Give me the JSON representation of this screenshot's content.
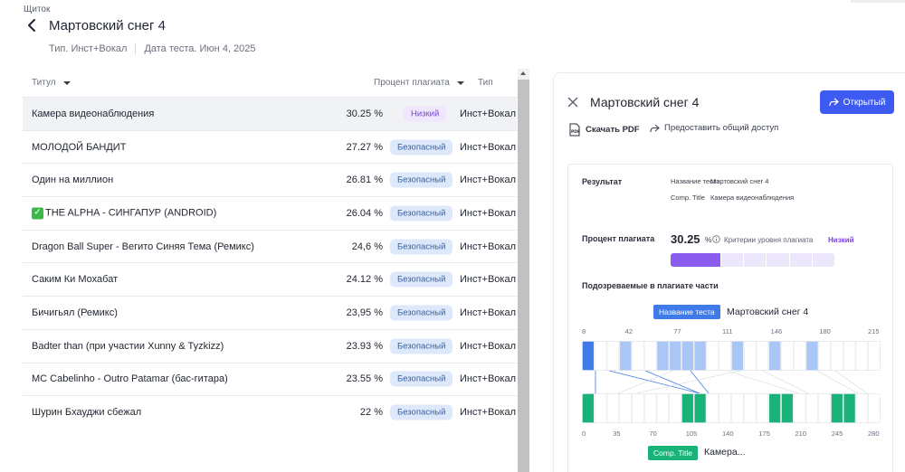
{
  "breadcrumb": "Щиток",
  "page_title": "Мартовский снег 4",
  "meta": {
    "type": "Тип. Инст+Вокал",
    "test_date": "Дата теста. Июн 4, 2025"
  },
  "columns": {
    "title": "Титул",
    "percent": "Процент плагиата",
    "type": "Тип"
  },
  "rows": [
    {
      "title": "Камера видеонаблюдения",
      "percent": "30.25 %",
      "level": "Низкий",
      "type": "Инст+Вокал",
      "selected": true
    },
    {
      "title": "МОЛОДОЙ БАНДИТ",
      "percent": "27.27 %",
      "level": "Безопасный",
      "type": "Инст+Вокал"
    },
    {
      "title": "Один на миллион",
      "percent": "26.81 %",
      "level": "Безопасный",
      "type": "Инст+Вокал"
    },
    {
      "title": "THE ALPHA - СИНГАПУР (ANDROID)",
      "percent": "26.04 %",
      "level": "Безопасный",
      "type": "Инст+Вокал",
      "check": true
    },
    {
      "title": "Dragon Ball Super - Вегито Синяя Тема (Ремикс)",
      "percent": "24,6 %",
      "level": "Безопасный",
      "type": "Инст+Вокал"
    },
    {
      "title": "Саким Ки Мохабат",
      "percent": "24.12 %",
      "level": "Безопасный",
      "type": "Инст+Вокал"
    },
    {
      "title": "Бичигьял (Ремикс)",
      "percent": "23,95 %",
      "level": "Безопасный",
      "type": "Инст+Вокал"
    },
    {
      "title": "Badter than (при участии Xunny & Tyzkizz)",
      "percent": "23.93 %",
      "level": "Безопасный",
      "type": "Инст+Вокал"
    },
    {
      "title": "MC Cabelinho - Outro Patamar (бас-гитара)",
      "percent": "23.55 %",
      "level": "Безопасный",
      "type": "Инст+Вокал"
    },
    {
      "title": "Шурин Бхауджи сбежал",
      "percent": "22 %",
      "level": "Безопасный",
      "type": "Инст+Вокал"
    }
  ],
  "panel": {
    "title": "Мартовский снег 4",
    "open_button": "Открытый",
    "download_pdf": "Скачать PDF",
    "share": "Предоставить общий доступ",
    "result_label": "Результат",
    "test_name_label": "Название теста",
    "test_name_value": "Мартовский снег 4",
    "comp_title_label": "Comp. Title",
    "comp_title_value": "Камера видеонаблюдения",
    "plagiarism_label": "Процент плагиата",
    "plagiarism_value": "30.25",
    "plagiarism_unit": "%",
    "criteria_label": "Критерии уровня плагиата",
    "criteria_value": "Низкий",
    "plagiarism_fraction": 0.3025,
    "suspected_label": "Подозреваемые в плагиате части",
    "test_tag": "Название теста",
    "test_tag_value": "Мартовский снег 4",
    "comp_tag": "Comp. Title",
    "comp_tag_value": "Камера...",
    "top_axis": [
      "8",
      "42",
      "77",
      "111",
      "146",
      "180",
      "215"
    ],
    "bottom_axis": [
      "0",
      "35",
      "70",
      "105",
      "140",
      "175",
      "210",
      "245",
      "280"
    ]
  },
  "colors": {
    "accent": "#3d5af1",
    "low": "#7b3fe4",
    "safe_bg": "#dde9fb",
    "green": "#19b37a",
    "blue_seg": "#a9c6f6"
  }
}
